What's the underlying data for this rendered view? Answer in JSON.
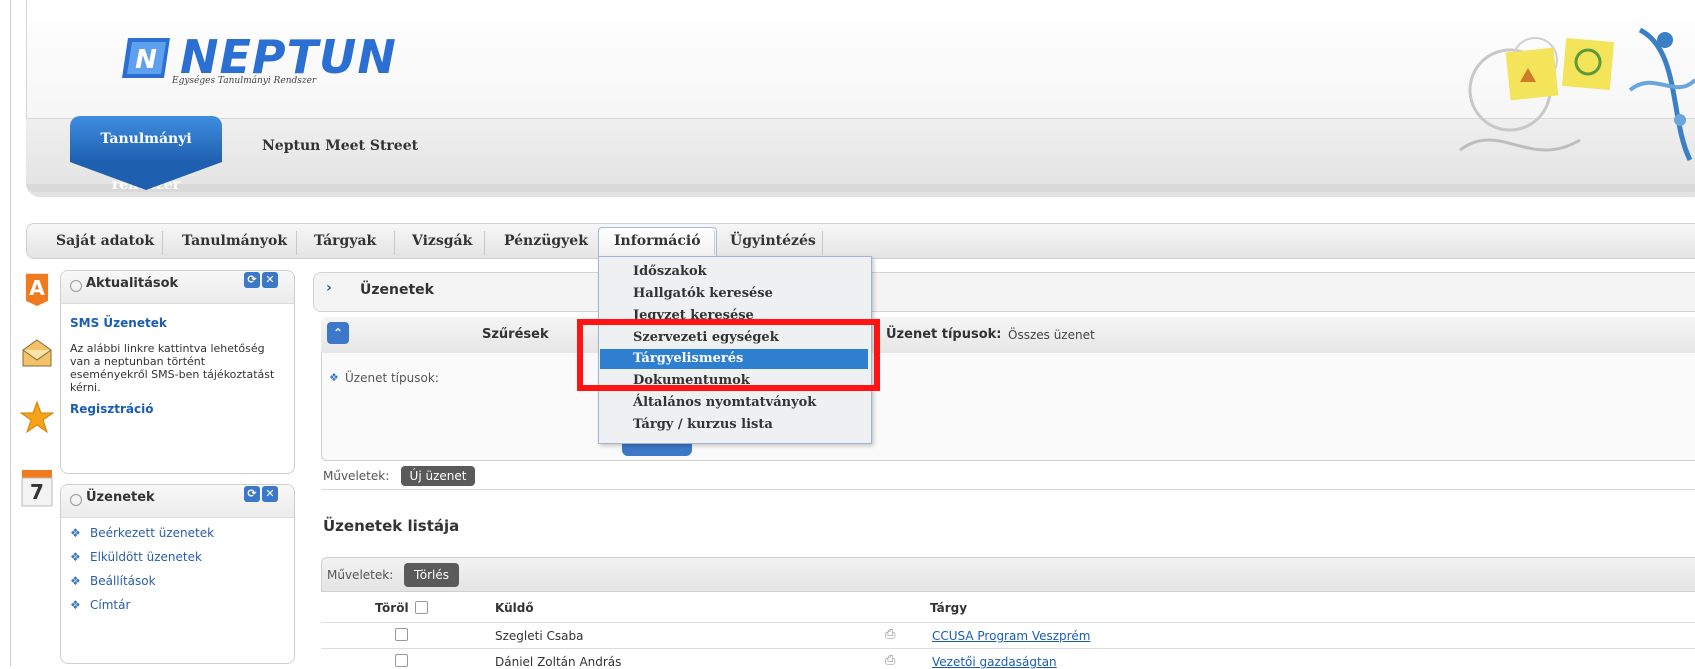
{
  "header": {
    "logo_text": "NEPTUN",
    "logo_sub": "Egységes Tanulmányi Rendszer",
    "site_tab": "Tanulmányi rendszer",
    "site_link": "Neptun Meet Street"
  },
  "nav": {
    "items": [
      "Saját adatok",
      "Tanulmányok",
      "Tárgyak",
      "Vizsgák",
      "Pénzügyek",
      "Információ",
      "Ügyintézés"
    ],
    "active": "Információ"
  },
  "dropdown": {
    "items": [
      "Időszakok",
      "Hallgatók keresése",
      "Jegyzet keresése",
      "Szervezeti egységek",
      "Tárgyelismerés",
      "Dokumentumok",
      "Általános nyomtatványok",
      "Tárgy / kurzus lista"
    ],
    "highlighted": "Tárgyelismerés",
    "highlight_color": "#2f7fd0",
    "annotation_color": "#ff1414"
  },
  "left_icons": [
    "A",
    "envelope-icon",
    "star-icon",
    "7"
  ],
  "aktualitasok": {
    "title": "Aktualitások",
    "sms_title": "SMS Üzenetek",
    "text": "Az alábbi linkre kattintva lehetőség van a neptunban történt eseményekről SMS-ben tájékoztatást kérni.",
    "link": "Regisztráció"
  },
  "uzenetek_box": {
    "title": "Üzenetek",
    "links": [
      "Beérkezett üzenetek",
      "Elküldött üzenetek",
      "Beállítások",
      "Címtár"
    ]
  },
  "content": {
    "breadcrumb": "Üzenetek",
    "filter_title": "Szűrések",
    "filter_type_label": "Üzenet típusok:",
    "filter_type_value": "Összes üzenet",
    "filter_field_label": "Üzenet típusok:",
    "ops_label": "Műveletek:",
    "new_message": "Új üzenet",
    "list_title": "Üzenetek listája",
    "list_ops_label": "Műveletek:",
    "delete_button": "Törlés",
    "columns": [
      "Töröl",
      "Küldő",
      "Tárgy"
    ],
    "rows": [
      {
        "sender": "Szegleti Csaba",
        "subject": "CCUSA Program Veszprém"
      },
      {
        "sender": "Dániel Zoltán András",
        "subject": "Vezetői gazdaságtan"
      }
    ]
  }
}
